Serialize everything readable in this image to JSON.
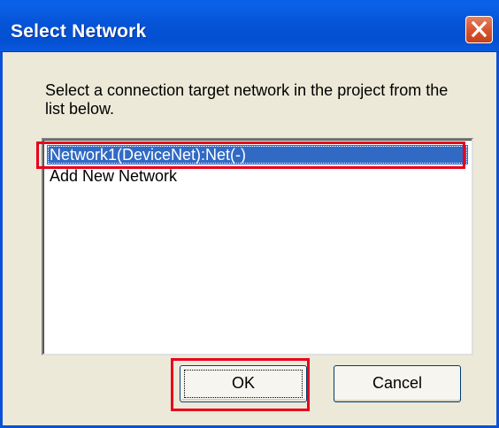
{
  "window": {
    "title": "Select Network"
  },
  "dialog": {
    "prompt": "Select a connection target network in the project from the list below.",
    "network_list": [
      {
        "label": "Network1(DeviceNet):Net(-)",
        "selected": true
      },
      {
        "label": "Add New Network",
        "selected": false
      }
    ],
    "ok_label": "OK",
    "cancel_label": "Cancel"
  },
  "icons": {
    "close": "close-icon"
  },
  "colors": {
    "titlebar": "#0553d6",
    "selection": "#316ac5",
    "highlight": "#e8001c",
    "dialog_background": "#ece9d8",
    "close_button": "#d8562f"
  }
}
